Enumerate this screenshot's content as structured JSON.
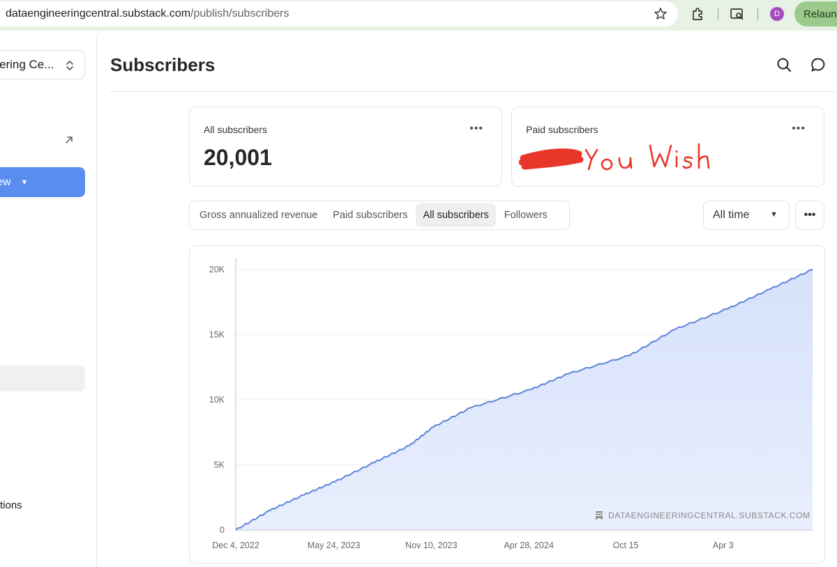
{
  "browser": {
    "url_host": "dataengineeringcentral.substack.com",
    "url_path": "/publish/subscribers",
    "profile_initial": "D",
    "relaunch_label": "Relaunc"
  },
  "sidebar": {
    "publication_name": "ering Ce...",
    "new_button_label": "ew",
    "options_label": "tions"
  },
  "header": {
    "title": "Subscribers"
  },
  "cards": {
    "all": {
      "label": "All subscribers",
      "value": "20,001"
    },
    "paid": {
      "label": "Paid subscribers",
      "handwritten_note": "You Wish"
    }
  },
  "tabs": [
    {
      "label": "Gross annualized revenue",
      "active": false
    },
    {
      "label": "Paid subscribers",
      "active": false
    },
    {
      "label": "All subscribers",
      "active": true
    },
    {
      "label": "Followers",
      "active": false
    }
  ],
  "range_select": {
    "value": "All time"
  },
  "colors": {
    "accent": "#5b8def",
    "line": "#5b84d8",
    "fill": "#d6e1fb",
    "scribble": "#e8372a"
  },
  "chart_data": {
    "type": "area",
    "title": "",
    "xlabel": "",
    "ylabel": "",
    "x_tick_labels": [
      "Dec 4, 2022",
      "May 24, 2023",
      "Nov 10, 2023",
      "Apr 28, 2024",
      "Oct 15",
      "Apr 3"
    ],
    "y_tick_labels": [
      "0",
      "5K",
      "10K",
      "15K",
      "20K"
    ],
    "ylim": [
      0,
      20000
    ],
    "grid": true,
    "watermark": "DATAENGINEERINGCENTRAL.SUBSTACK.COM",
    "series": [
      {
        "x": [
          "Dec 4, 2022",
          "Feb 1, 2023",
          "Apr 1, 2023",
          "May 24, 2023",
          "Aug 1, 2023",
          "Oct 1, 2023",
          "Nov 10, 2023",
          "Jan 15, 2024",
          "Apr 28, 2024",
          "Jul 1, 2024",
          "Oct 15, 2024",
          "Jan 1, 2025",
          "Apr 3, 2025",
          "Jun 15, 2025",
          "Aug 27, 2025"
        ],
        "values": [
          0,
          1500,
          2700,
          3700,
          5200,
          6500,
          7900,
          9400,
          10800,
          12000,
          13400,
          15400,
          17000,
          18500,
          20001
        ]
      }
    ]
  }
}
